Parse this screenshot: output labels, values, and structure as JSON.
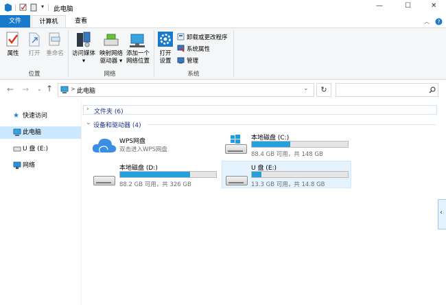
{
  "window": {
    "title": "此电脑",
    "minimize_glyph": "—",
    "maximize_glyph": "☐",
    "close_glyph": "✕"
  },
  "tabs": [
    {
      "label": "文件"
    },
    {
      "label": "计算机"
    },
    {
      "label": "查看"
    }
  ],
  "ribbon": {
    "location_group": {
      "label": "位置",
      "buttons": [
        {
          "label": "属性"
        },
        {
          "label": "打开"
        },
        {
          "label": "重命名"
        }
      ]
    },
    "network_group": {
      "label": "网络",
      "buttons": [
        {
          "label1": "访问媒体",
          "label2": "▾"
        },
        {
          "label1": "映射网络",
          "label2": "驱动器 ▾"
        },
        {
          "label1": "添加一个",
          "label2": "网络位置"
        }
      ]
    },
    "system_group": {
      "label": "系统",
      "open_settings": {
        "label1": "打开",
        "label2": "设置"
      },
      "small_buttons": [
        {
          "label": "卸载或更改程序"
        },
        {
          "label": "系统属性"
        },
        {
          "label": "管理"
        }
      ]
    }
  },
  "address_bar": {
    "path": "此电脑",
    "separator": ">"
  },
  "sidebar": {
    "items": [
      {
        "label": "快速访问",
        "icon": "star-icon"
      },
      {
        "label": "此电脑",
        "icon": "computer-icon",
        "selected": true
      },
      {
        "label": "U 盘 (E:)",
        "icon": "usb-drive-icon"
      },
      {
        "label": "网络",
        "icon": "network-icon"
      }
    ]
  },
  "content": {
    "folders_group": {
      "label": "文件夹 (6)"
    },
    "drives_group": {
      "label": "设备和驱动器 (4)"
    },
    "drives": [
      {
        "name": "WPS网盘",
        "sub": "双击进入WPS网盘",
        "icon": "cloud-icon"
      },
      {
        "name": "本地磁盘 (C:)",
        "sub": "88.4 GB 可用，共 148 GB",
        "used_fraction": 0.4
      },
      {
        "name": "本地磁盘 (D:)",
        "sub": "88.2 GB 可用，共 326 GB",
        "used_fraction": 0.73
      },
      {
        "name": "U 盘 (E:)",
        "sub": "13.3 GB 可用，共 14.8 GB",
        "used_fraction": 0.1,
        "selected": true
      }
    ]
  },
  "colors": {
    "accent": "#1979ca",
    "bar_fill": "#26a0da",
    "selection": "#cce8ff",
    "selection_light": "#e5f3ff",
    "group_header": "#1e3287"
  }
}
